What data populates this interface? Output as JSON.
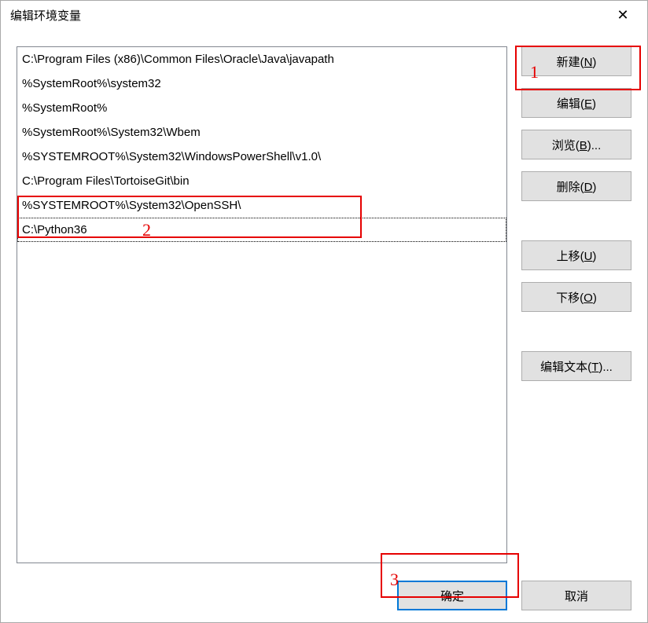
{
  "titlebar": {
    "title": "编辑环境变量"
  },
  "list": {
    "items": [
      "C:\\Program Files (x86)\\Common Files\\Oracle\\Java\\javapath",
      "%SystemRoot%\\system32",
      "%SystemRoot%",
      "%SystemRoot%\\System32\\Wbem",
      "%SYSTEMROOT%\\System32\\WindowsPowerShell\\v1.0\\",
      "C:\\Program Files\\TortoiseGit\\bin",
      "%SYSTEMROOT%\\System32\\OpenSSH\\",
      "C:\\Python36"
    ],
    "selectedIndex": 7
  },
  "buttons": {
    "new": "新建(N)",
    "edit": "编辑(E)",
    "browse": "浏览(B)...",
    "delete": "删除(D)",
    "moveUp": "上移(U)",
    "moveDown": "下移(O)",
    "editText": "编辑文本(T)...",
    "ok": "确定",
    "cancel": "取消"
  },
  "annotations": {
    "a1": "1",
    "a2": "2",
    "a3": "3"
  }
}
